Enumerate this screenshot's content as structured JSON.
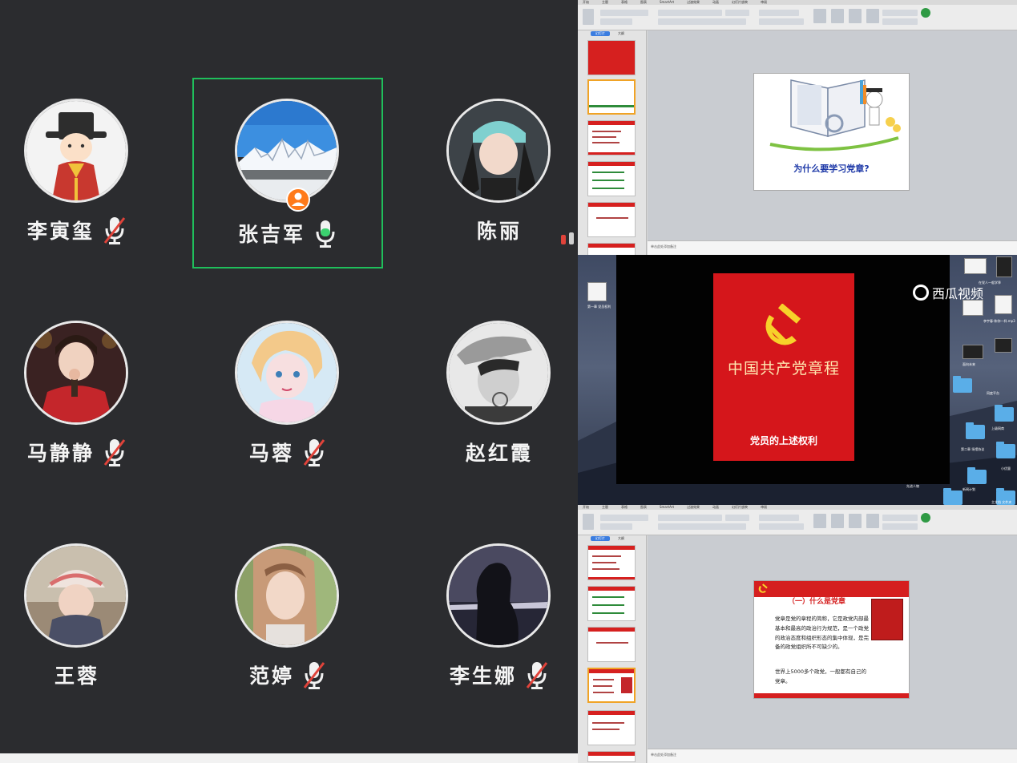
{
  "participants": [
    {
      "name": "李寅玺",
      "mic": "muted",
      "avatar": "cartoon-scholar"
    },
    {
      "name": "张吉军",
      "mic": "on",
      "avatar": "snow-mountain",
      "speaking": true,
      "host": true
    },
    {
      "name": "陈丽",
      "mic": "none",
      "avatar": "girl-cap"
    },
    {
      "name": "马静静",
      "mic": "muted",
      "avatar": "girl-red"
    },
    {
      "name": "马蓉",
      "mic": "muted",
      "avatar": "anime-girl"
    },
    {
      "name": "赵红霞",
      "mic": "none",
      "avatar": "bw-portrait"
    },
    {
      "name": "王蓉",
      "mic": "none",
      "avatar": "girl-helmet"
    },
    {
      "name": "范婷",
      "mic": "muted",
      "avatar": "girl-selfie"
    },
    {
      "name": "李生娜",
      "mic": "muted",
      "avatar": "silhouette-sea"
    }
  ],
  "ppt_top": {
    "tabs": [
      "开始",
      "主题",
      "表格",
      "图表",
      "SmartArt",
      "过渡效果",
      "动画",
      "幻灯片放映",
      "审阅"
    ],
    "panel_tabs": [
      "幻灯片",
      "大纲"
    ],
    "slide_title": "为什么要学习党章?",
    "notes": "单击此处添加备注"
  },
  "video": {
    "book_title": "中国共产党章程",
    "subtitle": "党员的上述权利",
    "watermark": "西瓜视频"
  },
  "desktop": {
    "labels": [
      "第一章 党员权利",
      "在党人一般学季",
      "李宇春-和你一样.mp3",
      "面向未来",
      "同度平台",
      "上级网商",
      "第二章 场馆协议",
      "小优量",
      "新闻计划",
      "先进人物",
      "主文档 文件夹"
    ]
  },
  "ppt_bottom": {
    "tabs": [
      "开始",
      "主题",
      "表格",
      "图表",
      "SmartArt",
      "过渡效果",
      "动画",
      "幻灯片放映",
      "审阅"
    ],
    "panel_tabs": [
      "幻灯片",
      "大纲"
    ],
    "slide_heading": "（一）什么是党章",
    "slide_body": "党章是党的章程的简称，它是政党内部最基本和最高的政治行为规范，是一个政党的政治态度和组织形态的集中体现，是完备的政党组织所不可缺少的。",
    "slide_body2": "世界上5000多个政党，一般都有自己的党章。",
    "notes": "单击此处添加备注"
  },
  "colors": {
    "background": "#2b2c2f",
    "active_border": "#1fbf5b",
    "mic_on": "#3bd16f",
    "mic_muted": "#e0433a",
    "party_red": "#d5161b"
  }
}
